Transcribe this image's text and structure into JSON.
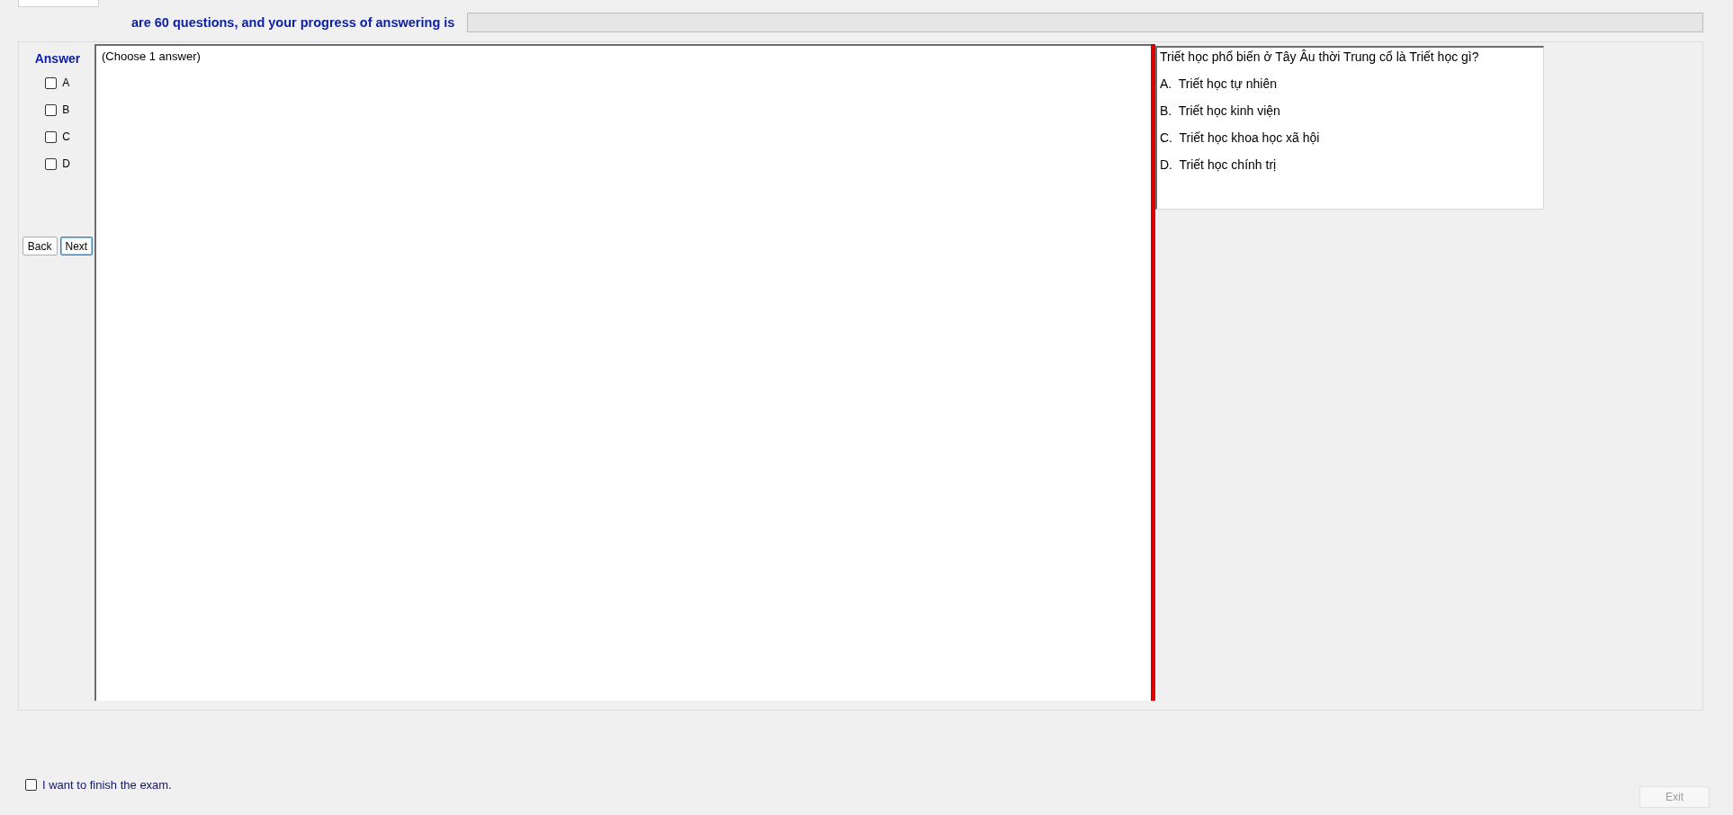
{
  "header": {
    "progress_text": "are 60 questions, and your progress of answering is",
    "progress": {
      "level": 0
    }
  },
  "answer_panel": {
    "title": "Answer",
    "options": [
      {
        "label": "A",
        "checked": false
      },
      {
        "label": "B",
        "checked": false
      },
      {
        "label": "C",
        "checked": false
      },
      {
        "label": "D",
        "checked": false
      }
    ],
    "buttons": [
      {
        "label": "Back",
        "focused": false
      },
      {
        "label": "Next",
        "focused": true
      }
    ]
  },
  "answer_area": {
    "instruction": "(Choose 1 answer)"
  },
  "question": {
    "text": "Triết học phổ biến ở Tây Âu thời Trung cổ là Triết học gì?",
    "choices": [
      "A.  Triết học tự nhiên",
      "B.  Triết học kinh viện",
      "C.  Triết học khoa học xã hội",
      "D.  Triết học chính trị"
    ]
  },
  "footer": {
    "finish": {
      "label": "I want to finish the exam.",
      "checked": false
    },
    "exit_button": {
      "label": "Exit",
      "disabled": true
    }
  }
}
